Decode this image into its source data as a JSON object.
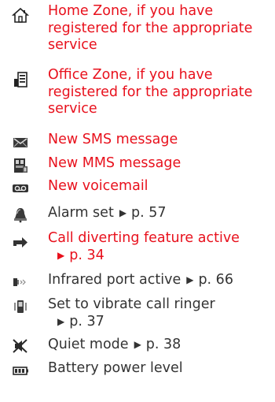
{
  "items": [
    {
      "icon": "home-zone-icon",
      "lines": [
        "Home Zone, if you have",
        "registered for the appropriate",
        "service"
      ],
      "color": "#e8101c"
    },
    {
      "icon": "office-zone-icon",
      "lines": [
        "Office Zone, if you have",
        "registered for the appropriate",
        "service"
      ],
      "color": "#e8101c"
    },
    {
      "icon": "sms-envelope-icon",
      "text": "New SMS message",
      "color": "#e8101c"
    },
    {
      "icon": "mms-message-icon",
      "text": "New MMS message",
      "color": "#e8101c"
    },
    {
      "icon": "voicemail-icon",
      "text": "New voicemail",
      "color": "#e8101c"
    },
    {
      "icon": "alarm-bell-icon",
      "text": "Alarm set",
      "ref": "p. 57",
      "color": "#333333"
    },
    {
      "icon": "call-divert-icon",
      "text": "Call diverting feature active",
      "ref": "p. 34",
      "color": "#e8101c"
    },
    {
      "icon": "infrared-port-icon",
      "text": "Infrared port active",
      "ref": "p. 66",
      "color": "#333333"
    },
    {
      "icon": "vibrate-icon",
      "text": "Set to vibrate call ringer",
      "ref": "p. 37",
      "color": "#333333"
    },
    {
      "icon": "quiet-mode-icon",
      "text": "Quiet mode",
      "ref": "p. 38",
      "color": "#333333"
    },
    {
      "icon": "battery-level-icon",
      "text": "Battery power level",
      "color": "#333333"
    }
  ]
}
